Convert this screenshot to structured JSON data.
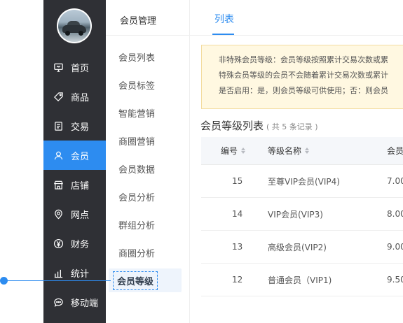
{
  "sidebar": {
    "items": [
      {
        "label": "首页",
        "icon": "monitor-icon"
      },
      {
        "label": "商品",
        "icon": "tag-icon"
      },
      {
        "label": "交易",
        "icon": "document-icon"
      },
      {
        "label": "会员",
        "icon": "user-icon",
        "active": true
      },
      {
        "label": "店铺",
        "icon": "store-icon"
      },
      {
        "label": "网点",
        "icon": "location-icon"
      },
      {
        "label": "财务",
        "icon": "yuan-icon"
      },
      {
        "label": "统计",
        "icon": "bar-chart-icon"
      },
      {
        "label": "移动端",
        "icon": "chat-icon"
      }
    ]
  },
  "submenu": {
    "title": "会员管理",
    "items": [
      "会员列表",
      "会员标签",
      "智能营销",
      "商圈营销",
      "会员数据",
      "会员分析",
      "群组分析",
      "商圈分析",
      "会员等级"
    ],
    "active": "会员等级"
  },
  "tabs": {
    "active_label": "列表"
  },
  "notice": {
    "lines": [
      "非特殊会员等级：会员等级按照累计交易次数或累",
      "特殊会员等级的会员不会随着累计交易次数或累计",
      "是否启用：是，则会员等级可供使用；否：则会员"
    ]
  },
  "list": {
    "title": "会员等级列表",
    "count": "( 共 5 条记录 )",
    "columns": [
      "编号",
      "等级名称",
      "会员"
    ],
    "rows": [
      {
        "id": "15",
        "name": "至尊VIP会员(VIP4)",
        "value": "7.00"
      },
      {
        "id": "14",
        "name": "VIP会员(VIP3)",
        "value": "8.00"
      },
      {
        "id": "13",
        "name": "高级会员(VIP2)",
        "value": "9.00"
      },
      {
        "id": "12",
        "name": "普通会员（VIP1)",
        "value": "9.50"
      }
    ]
  },
  "colors": {
    "accent": "#2d8cf0",
    "sidebar_bg": "#2f3035",
    "notice_bg": "#fff8e1"
  }
}
